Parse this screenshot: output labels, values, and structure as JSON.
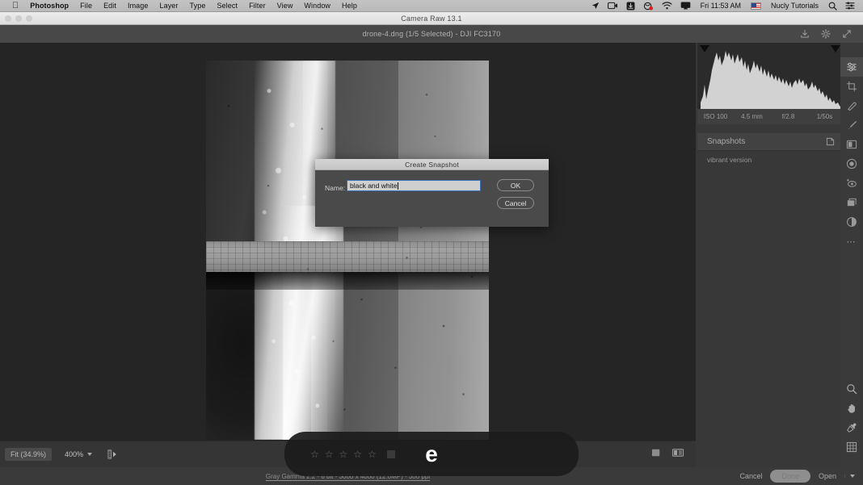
{
  "menubar": {
    "apple_icon": "apple-logo-icon",
    "items": [
      {
        "label": "Photoshop",
        "bold": true
      },
      {
        "label": "File",
        "bold": false
      },
      {
        "label": "Edit",
        "bold": false
      },
      {
        "label": "Image",
        "bold": false
      },
      {
        "label": "Layer",
        "bold": false
      },
      {
        "label": "Type",
        "bold": false
      },
      {
        "label": "Select",
        "bold": false
      },
      {
        "label": "Filter",
        "bold": false
      },
      {
        "label": "View",
        "bold": false
      },
      {
        "label": "Window",
        "bold": false
      },
      {
        "label": "Help",
        "bold": false
      }
    ],
    "status_icons": [
      "location-arrow-icon",
      "screen-record-icon",
      "download-icon",
      "recording-dot-icon",
      "wifi-icon",
      "airplay-icon"
    ],
    "clock": "Fri 11:53 AM",
    "flag": "us-flag-icon",
    "user": "Nucly Tutorials",
    "search_icon": "search-icon",
    "controlcenter_icon": "control-center-icon"
  },
  "window": {
    "title": "Camera Raw 13.1",
    "filename": "drone-4.dng (1/5 Selected)  -  DJI FC3170",
    "titlebar_icons": [
      "save-icon",
      "gear-icon",
      "fullscreen-icon"
    ]
  },
  "canvas": {
    "photo_alt": "black-and-white aerial drone photo of beach shoreline with boardwalk"
  },
  "image_toolbar": {
    "zoom_fit": "Fit (34.9%)",
    "zoom_level": "400%",
    "filmstrip_icon": "filmstrip-toggle-icon",
    "view_single_icon": "single-view-icon",
    "view_compare_icon": "before-after-view-icon"
  },
  "hud": {
    "stars": [
      "☆",
      "☆",
      "☆",
      "☆",
      "☆"
    ],
    "key_pressed": "e"
  },
  "workflow": {
    "link": "Gray Gamma 2.2 - 8 bit - 3000 x 4000 (12.0MP) - 300 ppi"
  },
  "right_panel": {
    "histogram": {
      "clip_shadow_icon": "shadow-clipping-icon",
      "clip_highlight_icon": "highlight-clipping-icon"
    },
    "exif": [
      "ISO 100",
      "4.5 mm",
      "f/2.8",
      "1/50s"
    ],
    "snapshots": {
      "title": "Snapshots",
      "add_icon": "new-snapshot-icon",
      "items": [
        {
          "label": "vibrant version"
        }
      ]
    }
  },
  "toolrail": {
    "tools": [
      {
        "name": "edit-sliders-icon",
        "active": true
      },
      {
        "name": "crop-icon",
        "active": false
      },
      {
        "name": "spot-removal-icon",
        "active": false
      },
      {
        "name": "adjustment-brush-icon",
        "active": false
      },
      {
        "name": "masking-icon",
        "active": false
      },
      {
        "name": "radial-filter-icon",
        "active": false
      },
      {
        "name": "red-eye-icon",
        "active": false
      },
      {
        "name": "presets-icon",
        "active": false
      },
      {
        "name": "snapshots-icon",
        "active": false
      },
      {
        "name": "more-options-icon",
        "active": false
      }
    ],
    "bottom_tools": [
      {
        "name": "zoom-tool-icon"
      },
      {
        "name": "hand-tool-icon"
      },
      {
        "name": "eyedropper-tool-icon"
      },
      {
        "name": "grid-overlay-icon"
      }
    ]
  },
  "bottom_bar": {
    "cancel": "Cancel",
    "done": "Done",
    "open": "Open",
    "open_chevron_icon": "chevron-down-icon"
  },
  "dialog": {
    "title": "Create Snapshot",
    "name_label": "Name:",
    "name_value": "black and white",
    "name_placeholder": "",
    "ok": "OK",
    "cancel": "Cancel"
  },
  "colors": {
    "menubar_bg": "#c0c0c0",
    "panel_bg": "#383838",
    "canvas_bg": "#252525",
    "dialog_bg": "#4a4a4a",
    "focus_blue": "#3b6fb5",
    "text_muted": "#9d9d9d"
  }
}
